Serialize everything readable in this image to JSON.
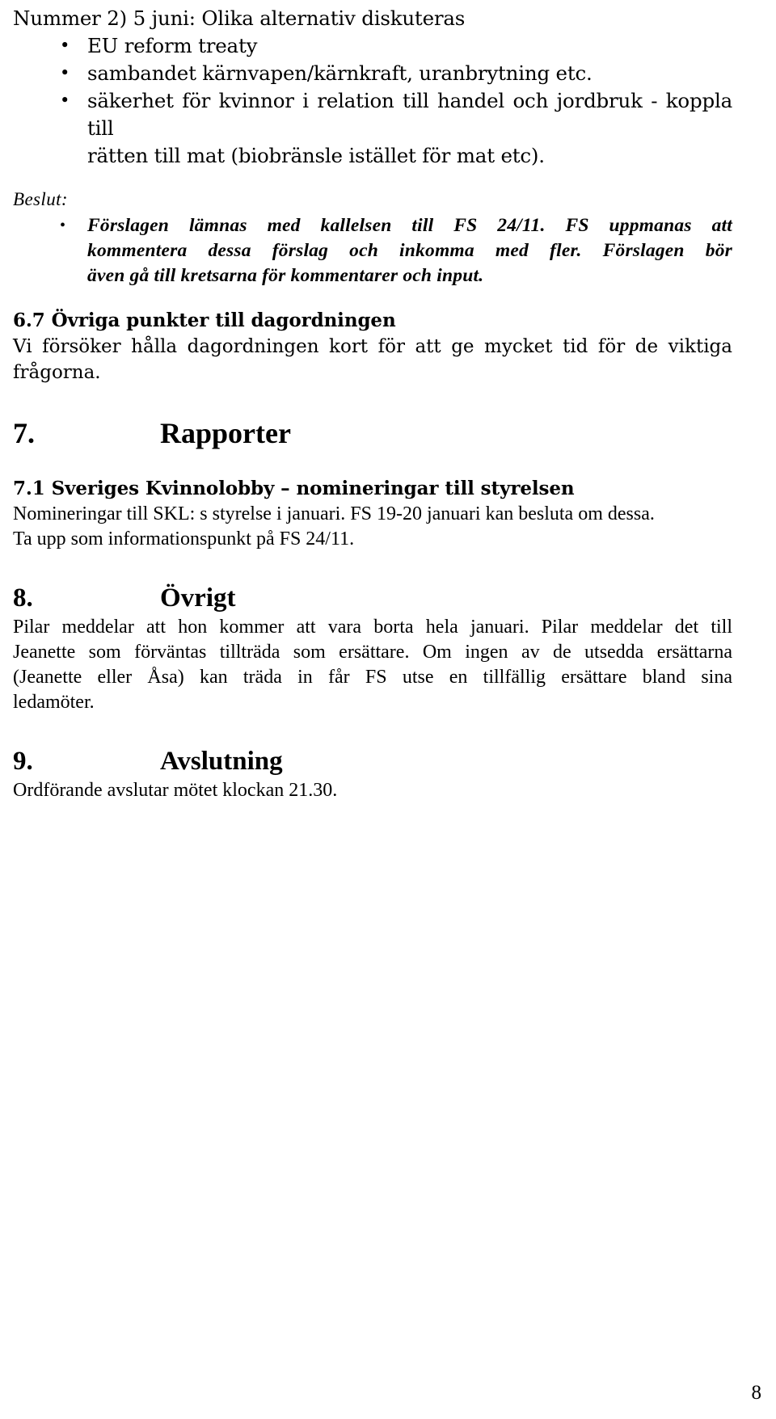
{
  "document": {
    "page_number": "8",
    "intro": {
      "lead_line": "Nummer 2) 5 juni: Olika alternativ diskuteras",
      "bullets": [
        {
          "line1": "EU reform treaty"
        },
        {
          "line1": "sambandet kärnvapen/kärnkraft, uranbrytning etc."
        },
        {
          "line1": "säkerhet för kvinnor i relation till handel och jordbruk - koppla till",
          "line2": "rätten till mat (biobränsle istället för mat etc)."
        }
      ]
    },
    "beslut": {
      "label": "Beslut:",
      "bullet": {
        "line1": "Förslagen lämnas med kallelsen till FS 24/11. FS uppmanas att",
        "line2": "kommentera dessa förslag och inkomma med fler. Förslagen bör",
        "line3": "även gå till kretsarna för kommentarer och input."
      }
    },
    "section_6_7": {
      "heading": "6.7 Övriga punkter till dagordningen",
      "body_line1": "Vi försöker hålla dagordningen  kort för att ge mycket tid för de viktiga",
      "body_line2": "frågorna."
    },
    "section_7": {
      "number": "7.",
      "title": "Rapporter"
    },
    "section_7_1": {
      "heading": "7.1 Sveriges Kvinnolobby – nomineringar till styrelsen",
      "body_line1": "Nomineringar till SKL: s styrelse i januari. FS 19-20 januari kan besluta om dessa.",
      "body_line2": "Ta upp som informationspunkt på FS 24/11."
    },
    "section_8": {
      "number": "8.",
      "title": "Övrigt",
      "body_line1": "Pilar meddelar att hon kommer att vara borta hela januari. Pilar meddelar det till",
      "body_line2": "Jeanette som förväntas tillträda som ersättare. Om ingen av de utsedda ersättarna",
      "body_line3": "(Jeanette eller Åsa) kan träda in får FS utse en tillfällig ersättare bland sina",
      "body_line4": "ledamöter."
    },
    "section_9": {
      "number": "9.",
      "title": "Avslutning",
      "body_line1": "Ordförande avslutar mötet klockan 21.30."
    }
  }
}
